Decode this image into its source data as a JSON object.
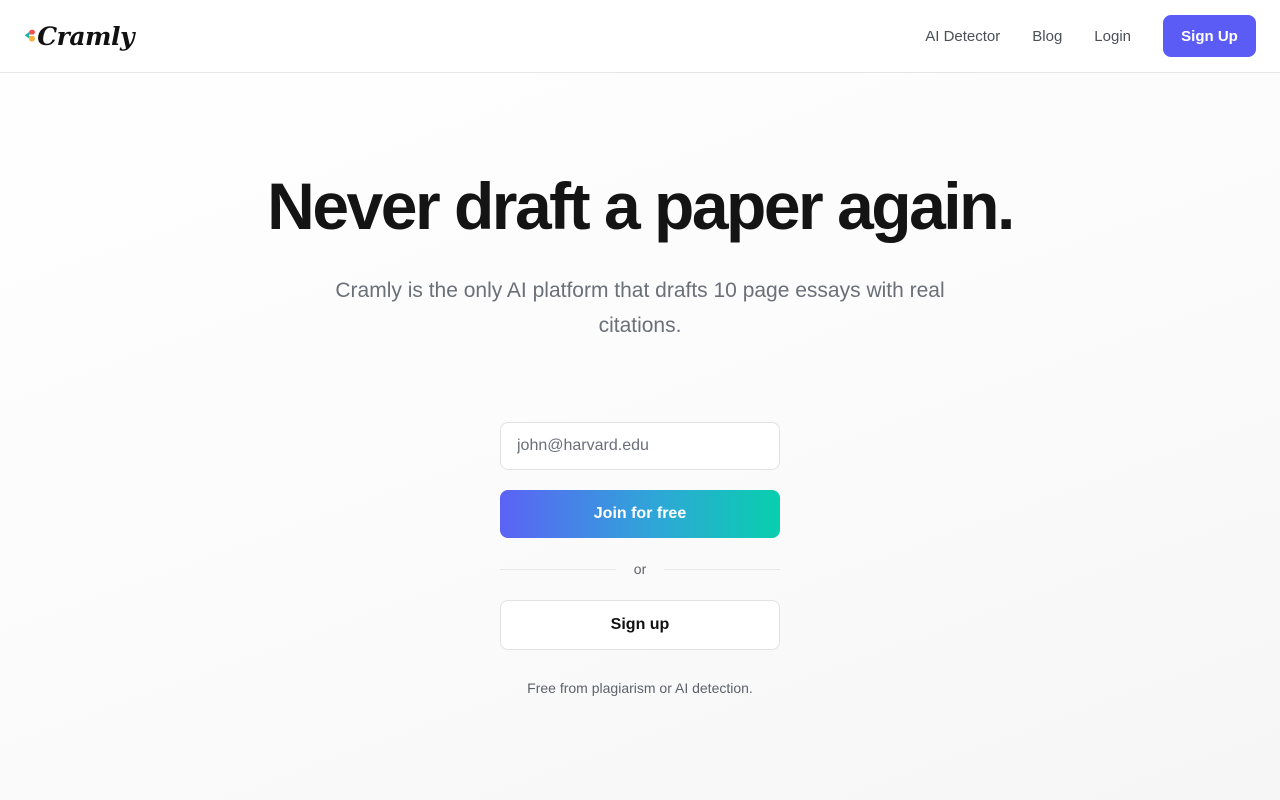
{
  "header": {
    "logo_text": "Cramly",
    "logo_icon": "heart-logo-icon",
    "nav": [
      {
        "label": "AI Detector"
      },
      {
        "label": "Blog"
      },
      {
        "label": "Login"
      }
    ],
    "signup_label": "Sign Up"
  },
  "hero": {
    "title": "Never draft a paper again.",
    "subtitle": "Cramly is the only AI platform that drafts 10 page essays with real citations."
  },
  "form": {
    "email_placeholder": "john@harvard.edu",
    "join_label": "Join for free",
    "divider_label": "or",
    "signup_label": "Sign up",
    "footnote": "Free from plagiarism or AI detection."
  },
  "colors": {
    "accent": "#5b5bf6",
    "gradient_start": "#5b63f5",
    "gradient_end": "#08cfae",
    "logo_teal": "#17b3a3",
    "logo_red": "#f0524f",
    "logo_yellow": "#f7b23b"
  }
}
